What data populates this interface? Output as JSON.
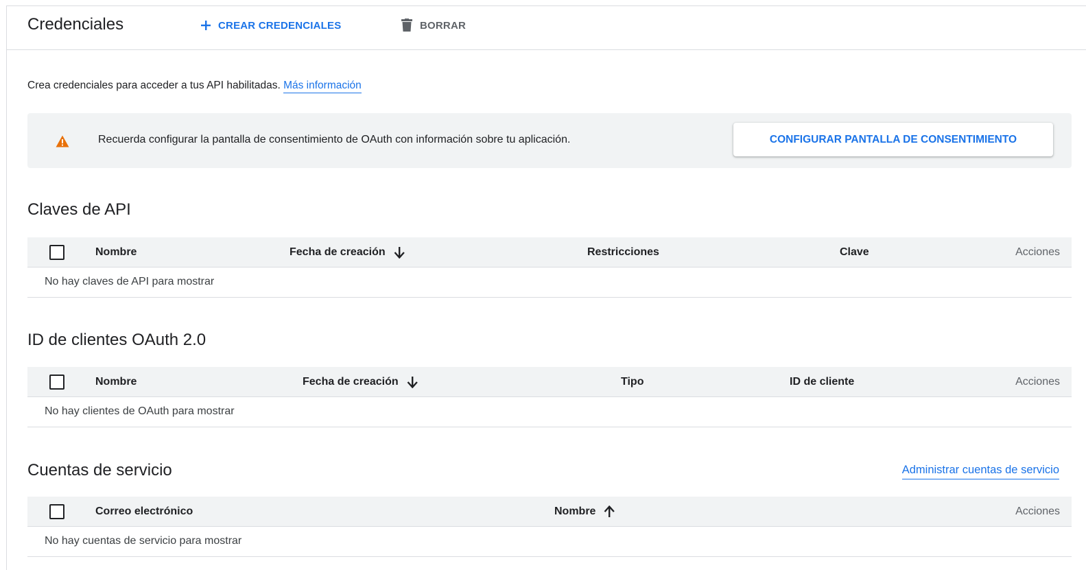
{
  "header": {
    "title": "Credenciales",
    "create_label": "CREAR CREDENCIALES",
    "delete_label": "BORRAR"
  },
  "intro": {
    "text": "Crea credenciales para acceder a tus API habilitadas.",
    "link": "Más información"
  },
  "banner": {
    "message": "Recuerda configurar la pantalla de consentimiento de OAuth con información sobre tu aplicación.",
    "button": "CONFIGURAR PANTALLA DE CONSENTIMIENTO",
    "icon": "warning-icon",
    "icon_color": "#e8710a"
  },
  "api_keys": {
    "title": "Claves de API",
    "columns": [
      "Nombre",
      "Fecha de creación",
      "Restricciones",
      "Clave",
      "Acciones"
    ],
    "empty": "No hay claves de API para mostrar"
  },
  "oauth": {
    "title": "ID de clientes OAuth 2.0",
    "columns": [
      "Nombre",
      "Fecha de creación",
      "Tipo",
      "ID de cliente",
      "Acciones"
    ],
    "empty": "No hay clientes de OAuth para mostrar"
  },
  "service_accounts": {
    "title": "Cuentas de servicio",
    "manage_link": "Administrar cuentas de servicio",
    "columns": [
      "Correo electrónico",
      "Nombre",
      "Acciones"
    ],
    "empty": "No hay cuentas de servicio para mostrar"
  },
  "colors": {
    "accent": "#1a73e8",
    "header_bg": "#f1f3f4",
    "warning": "#e8710a"
  }
}
